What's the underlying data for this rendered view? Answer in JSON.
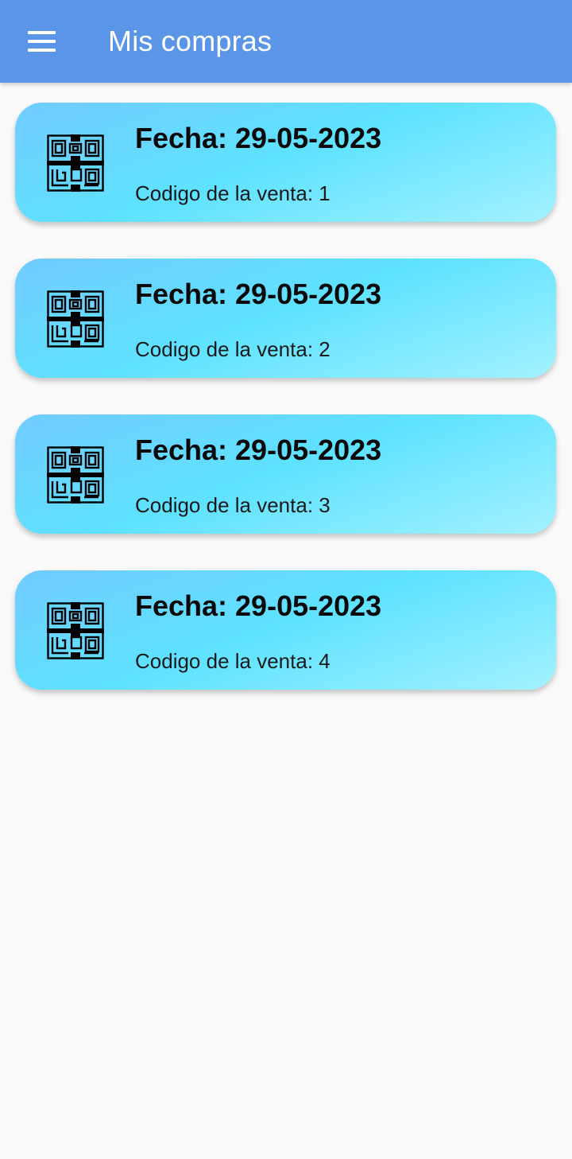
{
  "appbar": {
    "title": "Mis compras",
    "menu_icon": "hamburger-menu-icon",
    "background_color": "#5b95e8"
  },
  "purchases": [
    {
      "date_label": "Fecha: 29-05-2023",
      "code_label": "Codigo de la venta: 1",
      "icon": "qr-code-icon"
    },
    {
      "date_label": "Fecha: 29-05-2023",
      "code_label": "Codigo de la venta: 2",
      "icon": "qr-code-icon"
    },
    {
      "date_label": "Fecha: 29-05-2023",
      "code_label": "Codigo de la venta: 3",
      "icon": "qr-code-icon"
    },
    {
      "date_label": "Fecha: 29-05-2023",
      "code_label": "Codigo de la venta: 4",
      "icon": "qr-code-icon"
    }
  ]
}
